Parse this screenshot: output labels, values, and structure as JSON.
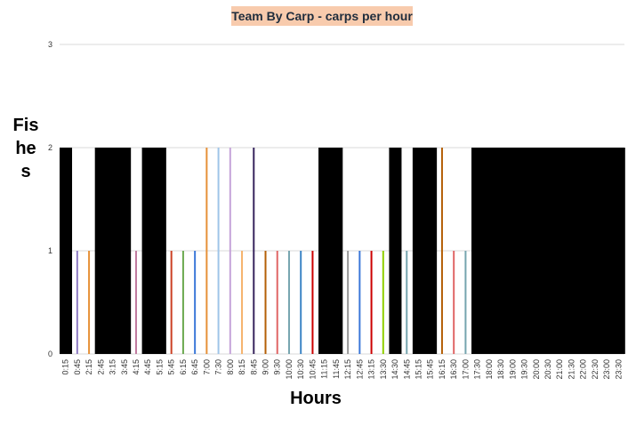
{
  "chart_data": {
    "type": "bar",
    "title": "Team By Carp - carps per hour",
    "xlabel": "Hours",
    "ylabel": "Fishes",
    "ylim": [
      0,
      3
    ],
    "yticks": [
      "0",
      "1",
      "2",
      "3"
    ],
    "grid": true,
    "legend": "none",
    "categories": [
      "0:15",
      "0:45",
      "2:15",
      "2:45",
      "3:15",
      "3:45",
      "4:15",
      "4:45",
      "5:15",
      "5:45",
      "6:15",
      "6:45",
      "7:00",
      "7:30",
      "8:00",
      "8:15",
      "8:45",
      "9:00",
      "9:30",
      "10:00",
      "10:30",
      "10:45",
      "11:15",
      "11:45",
      "12:15",
      "12:45",
      "13:15",
      "13:30",
      "14:30",
      "14:45",
      "15:15",
      "15:45",
      "16:15",
      "16:30",
      "17:00",
      "17:30",
      "18:00",
      "18:30",
      "19:00",
      "19:30",
      "20:00",
      "20:30",
      "21:00",
      "21:30",
      "22:00",
      "22:30",
      "23:00",
      "23:30"
    ],
    "values": [
      2,
      1,
      1,
      2,
      2,
      2,
      1,
      2,
      2,
      1,
      1,
      1,
      2,
      2,
      2,
      1,
      2,
      1,
      1,
      1,
      1,
      1,
      2,
      2,
      1,
      1,
      1,
      1,
      2,
      1,
      2,
      2,
      2,
      1,
      1,
      2,
      2,
      2,
      2,
      2,
      2,
      2,
      2,
      2,
      2,
      2,
      2,
      2
    ],
    "bar_colors": [
      "#000000",
      "#8e7cc3",
      "#e69138",
      "#000000",
      "#000000",
      "#000000",
      "#c27ba0",
      "#000000",
      "#000000",
      "#cc4125",
      "#6aa84f",
      "#3c78d8",
      "#e69138",
      "#9fc5e8",
      "#c5a3d9",
      "#f6b26b",
      "#38255e",
      "#b45f06",
      "#e06666",
      "#76a5af",
      "#3d85c6",
      "#cc0000",
      "#000000",
      "#000000",
      "#999999",
      "#3c78d8",
      "#cc0000",
      "#8fce00",
      "#000000",
      "#76a5af",
      "#000000",
      "#000000",
      "#b45f06",
      "#e06666",
      "#76a5af",
      "#000000",
      "#000000",
      "#000000",
      "#000000",
      "#000000",
      "#000000",
      "#000000",
      "#000000",
      "#000000",
      "#000000",
      "#000000",
      "#000000",
      "#000000"
    ]
  }
}
